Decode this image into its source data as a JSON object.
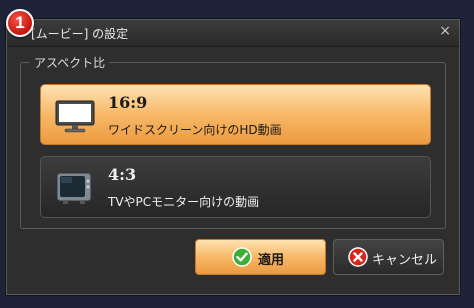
{
  "badge": {
    "number": "1"
  },
  "dialog": {
    "title": "[ムービー] の設定",
    "close_glyph": "×"
  },
  "group": {
    "label": "アスペクト比"
  },
  "options": [
    {
      "title": "16:9",
      "description": "ワイドスクリーン向けのHD動画",
      "icon": "widescreen-monitor-icon",
      "selected": true
    },
    {
      "title": "4:3",
      "description": "TVやPCモニター向けの動画",
      "icon": "crt-tv-icon",
      "selected": false
    }
  ],
  "buttons": {
    "apply_label": "適用",
    "apply_icon": "check-icon",
    "cancel_label": "キャンセル",
    "cancel_icon": "x-icon"
  },
  "colors": {
    "selected_accent": "#f8b868",
    "dialog_bg": "#2e2e2e",
    "badge_red": "#d9241b",
    "apply_icon_green": "#3aae35",
    "cancel_icon_red": "#d9241b"
  }
}
